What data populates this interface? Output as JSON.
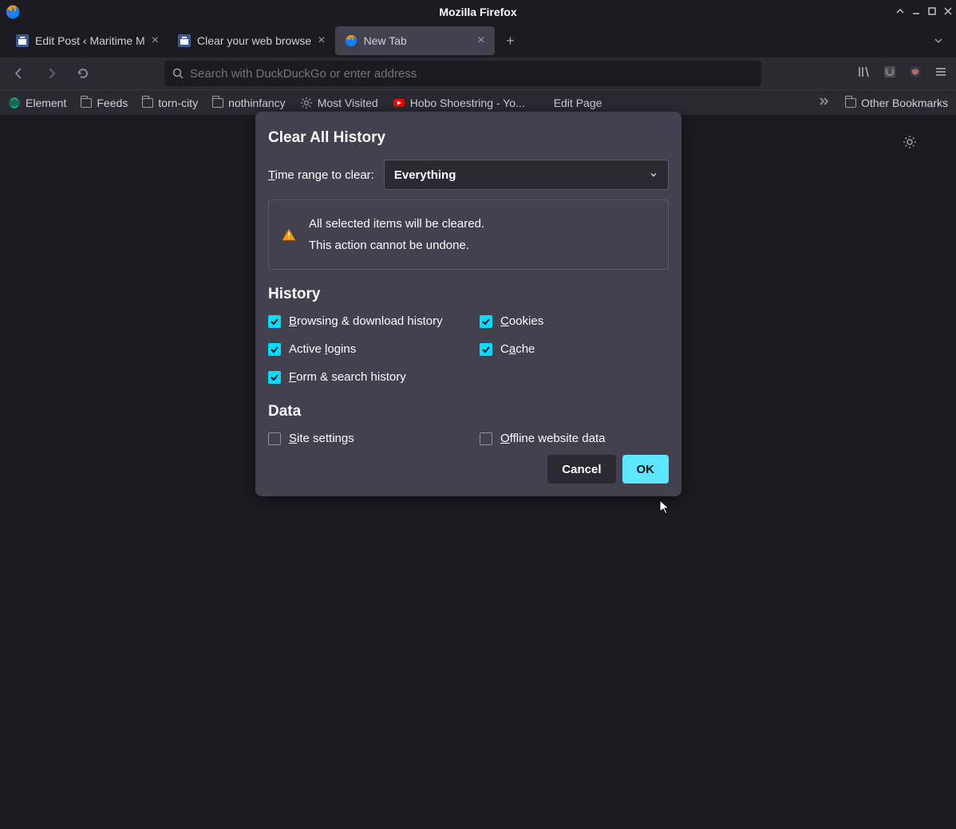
{
  "window": {
    "title": "Mozilla Firefox"
  },
  "tabs": [
    {
      "label": "Edit Post ‹ Maritime M"
    },
    {
      "label": "Clear your web browse"
    },
    {
      "label": "New Tab"
    }
  ],
  "urlbar": {
    "placeholder": "Search with DuckDuckGo or enter address"
  },
  "bookmarks": {
    "element": "Element",
    "feeds": "Feeds",
    "torncity": "torn-city",
    "nothinfancy": "nothinfancy",
    "mostvisited": "Most Visited",
    "hobo": "Hobo Shoestring - Yo...",
    "editpage": "Edit Page",
    "other": "Other Bookmarks"
  },
  "dialog": {
    "title": "Clear All History",
    "timerange_label_pre": "T",
    "timerange_label_post": "ime range to clear:",
    "timerange_value": "Everything",
    "warning_line1": "All selected items will be cleared.",
    "warning_line2": "This action cannot be undone.",
    "history_heading": "History",
    "data_heading": "Data",
    "items": {
      "browsing_pre": "B",
      "browsing_post": "rowsing & download history",
      "cookies_pre": "C",
      "cookies_post": "ookies",
      "logins_pre": "Active ",
      "logins_u": "l",
      "logins_post": "ogins",
      "cache_pre": "C",
      "cache_u": "a",
      "cache_post": "che",
      "form_pre": "F",
      "form_post": "orm & search history",
      "site_pre": "S",
      "site_post": "ite settings",
      "offline_pre": "O",
      "offline_post": "ffline website data"
    },
    "cancel": "Cancel",
    "ok": "OK"
  }
}
